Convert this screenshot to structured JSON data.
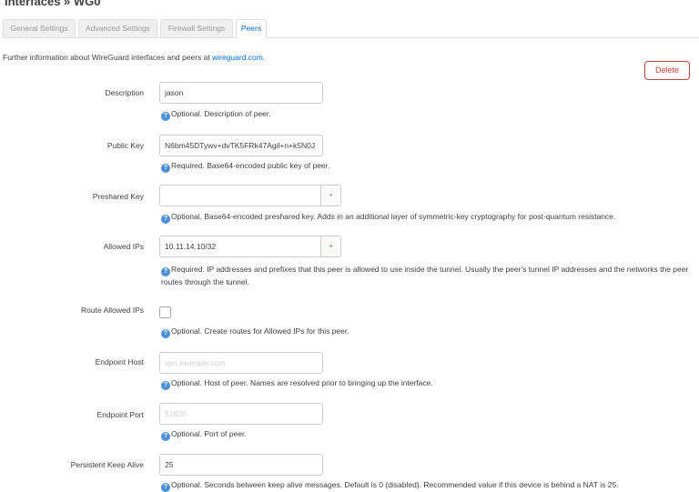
{
  "page": {
    "title": "Interfaces » WG0",
    "info_text": "Further information about WireGuard interfaces and peers at ",
    "info_link": "wireguard.com",
    "info_suffix": "."
  },
  "tabs": [
    "General Settings",
    "Advanced Settings",
    "Firewall Settings",
    "Peers"
  ],
  "active_tab": "Peers",
  "delete_label": "Delete",
  "fields": {
    "description": {
      "label": "Description",
      "value": "jason",
      "hint": "Optional. Description of peer."
    },
    "public_key": {
      "label": "Public Key",
      "value": "N6bm45DTywv+dvTK5FRk47Agil+n+k5N0J",
      "hint": "Required. Base64-encoded public key of peer."
    },
    "preshared_key": {
      "label": "Preshared Key",
      "value": "",
      "button": "•",
      "hint": "Optional. Base64-encoded preshared key. Adds in an additional layer of symmetric-key cryptography for post-quantum resistance."
    },
    "allowed_ips": {
      "label": "Allowed IPs",
      "value": "10.11.14.10/32",
      "button": "+",
      "hint": "Required. IP addresses and prefixes that this peer is allowed to use inside the tunnel. Usually the peer's tunnel IP addresses and the networks the peer routes through the tunnel."
    },
    "route_allowed_ips": {
      "label": "Route Allowed IPs",
      "hint": "Optional. Create routes for Allowed IPs for this peer."
    },
    "endpoint_host": {
      "label": "Endpoint Host",
      "placeholder": "vpn.example.com",
      "hint": "Optional. Host of peer. Names are resolved prior to bringing up the interface."
    },
    "endpoint_port": {
      "label": "Endpoint Port",
      "placeholder": "51820",
      "hint": "Optional. Port of peer."
    },
    "keepalive": {
      "label": "Persistent Keep Alive",
      "value": "25",
      "hint": "Optional. Seconds between keep alive messages. Default is 0 (disabled). Recommended value if this device is behind a NAT is 25."
    }
  },
  "help_icon_glyph": "?",
  "colors": {
    "link": "#0069d6",
    "danger": "#c0463f",
    "help_icon": "#4a90d9"
  }
}
